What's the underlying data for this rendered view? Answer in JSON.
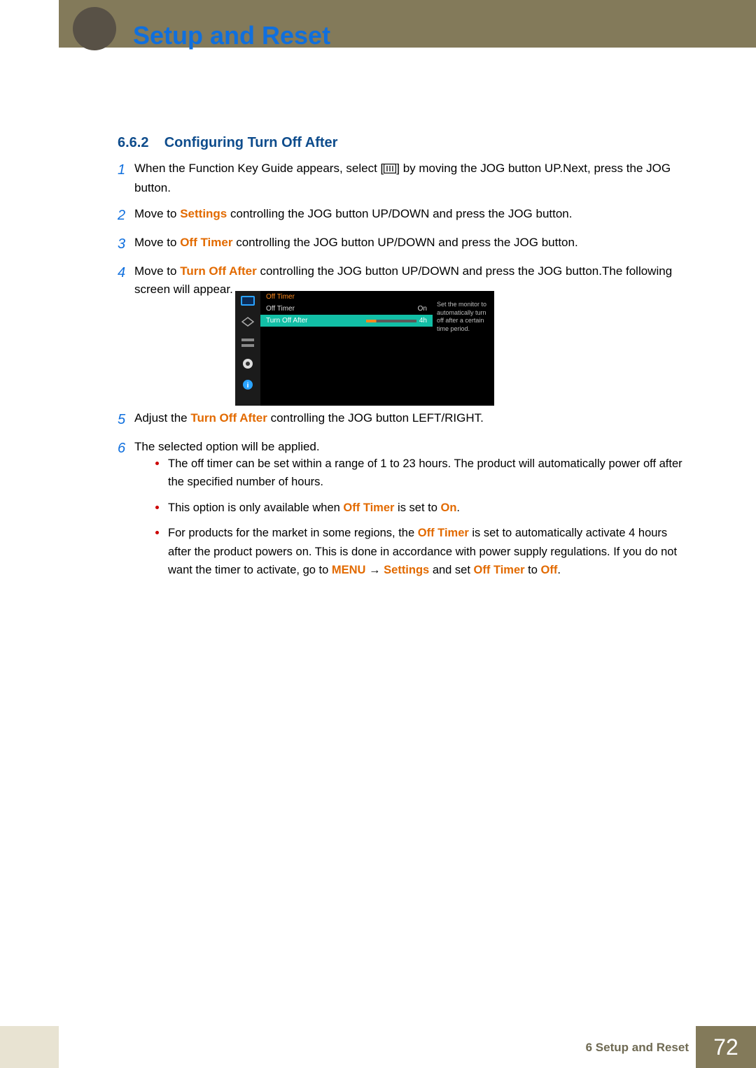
{
  "header": {
    "title": "Setup and Reset"
  },
  "section": {
    "number": "6.6.2",
    "title": "Configuring Turn Off After"
  },
  "steps": [
    {
      "n": "1",
      "parts": [
        {
          "t": "When the Function Key Guide appears, select ["
        },
        {
          "icon": "menu-box-icon"
        },
        {
          "t": "] by moving the JOG button UP."
        },
        {
          "br": true
        },
        {
          "t": "Next, press the JOG button."
        }
      ]
    },
    {
      "n": "2",
      "parts": [
        {
          "t": "Move to "
        },
        {
          "t": "Settings",
          "cls": "accent"
        },
        {
          "t": " controlling the JOG button UP/DOWN and press the JOG button."
        }
      ]
    },
    {
      "n": "3",
      "parts": [
        {
          "t": "Move to "
        },
        {
          "t": "Off Timer",
          "cls": "accent"
        },
        {
          "t": " controlling the JOG button UP/DOWN and press the JOG button."
        }
      ]
    },
    {
      "n": "4",
      "parts": [
        {
          "t": "Move to "
        },
        {
          "t": "Turn Off After",
          "cls": "accent"
        },
        {
          "t": " controlling the JOG button UP/DOWN and press the JOG button."
        },
        {
          "br": true
        },
        {
          "t": "The following screen will appear."
        }
      ]
    }
  ],
  "steps2": [
    {
      "n": "5",
      "parts": [
        {
          "t": "Adjust the "
        },
        {
          "t": "Turn Off After",
          "cls": "accent"
        },
        {
          "t": " controlling the JOG button LEFT/RIGHT."
        }
      ]
    },
    {
      "n": "6",
      "parts": [
        {
          "t": "The selected option will be applied."
        }
      ]
    }
  ],
  "osd": {
    "header": "Off Timer",
    "row1_label": "Off Timer",
    "row1_value": "On",
    "row2_label": "Turn Off After",
    "row2_value": "4h",
    "description": "Set the monitor to automatically turn off after a certain time period."
  },
  "bullets": [
    [
      {
        "t": "The off timer can be set within a range of 1 to 23 hours. The product will automatically power off after the specified number of hours."
      }
    ],
    [
      {
        "t": "This option is only available when "
      },
      {
        "t": "Off Timer",
        "cls": "accent"
      },
      {
        "t": " is set to "
      },
      {
        "t": "On",
        "cls": "accent"
      },
      {
        "t": "."
      }
    ],
    [
      {
        "t": "For products for the market in some regions, the "
      },
      {
        "t": "Off Timer",
        "cls": "accent"
      },
      {
        "t": " is set to automatically activate 4 hours after the product powers on. This is done in accordance with power supply regulations. If you do not want the timer to activate, go to "
      },
      {
        "t": "MENU",
        "cls": "accent"
      },
      {
        "t": " → "
      },
      {
        "t": "Settings",
        "cls": "accent"
      },
      {
        "t": " and set "
      },
      {
        "t": "Off Timer",
        "cls": "accent"
      },
      {
        "t": " to "
      },
      {
        "t": "Off",
        "cls": "accent"
      },
      {
        "t": "."
      }
    ]
  ],
  "footer": {
    "caption": "6 Setup and Reset",
    "page": "72"
  }
}
